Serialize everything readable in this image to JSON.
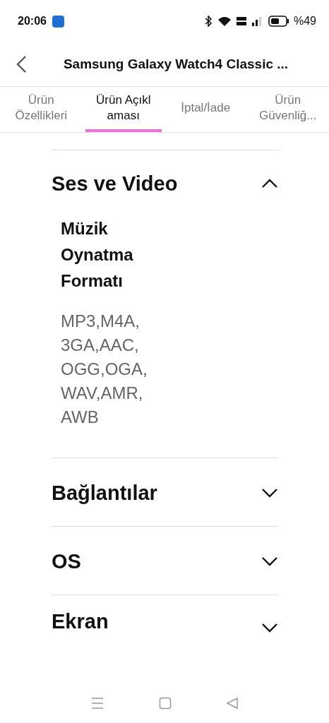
{
  "status_bar": {
    "time": "20:06",
    "battery": "%49"
  },
  "header": {
    "title": "Samsung Galaxy Watch4 Classic ..."
  },
  "tabs": [
    {
      "label": "Ürün Özellikleri",
      "selected": false
    },
    {
      "label": "Ürün Açıkl aması",
      "selected": true
    },
    {
      "label": "İptal/İade",
      "selected": false
    },
    {
      "label": "Ürün Güvenliğ...",
      "selected": false
    }
  ],
  "sections": [
    {
      "title": "Ses ve Video",
      "expanded": true,
      "specs": [
        {
          "label": "Müzik Oynatma Formatı",
          "value_lines": [
            "MP3,M4A,",
            "3GA,AAC,",
            "OGG,OGA,",
            "WAV,AMR,",
            "AWB"
          ]
        }
      ]
    },
    {
      "title": "Bağlantılar",
      "expanded": false
    },
    {
      "title": "OS",
      "expanded": false
    },
    {
      "title": "Ekran",
      "expanded": false
    }
  ]
}
